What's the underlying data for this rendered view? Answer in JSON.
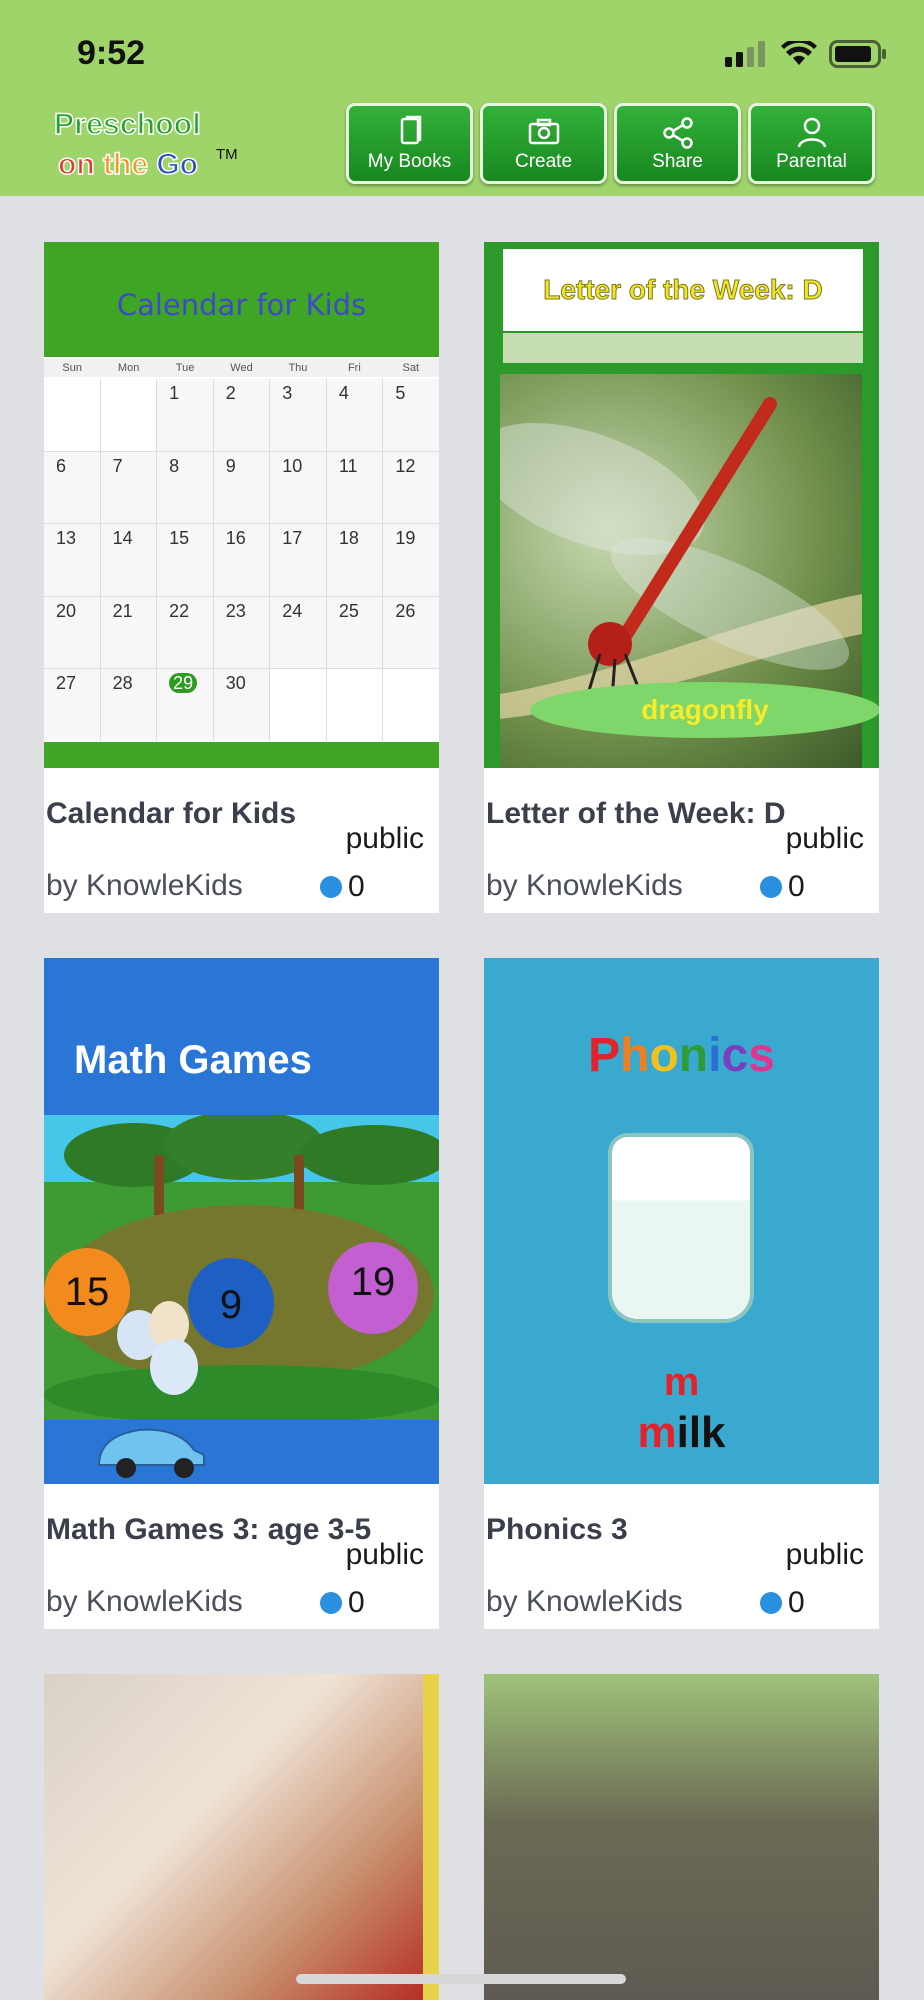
{
  "status_bar": {
    "time": "9:52"
  },
  "app": {
    "logo_line1": "Preschool",
    "logo_on": "on",
    "logo_the": "the",
    "logo_go": "Go",
    "logo_tm": "TM"
  },
  "nav": {
    "my_books": "My Books",
    "create": "Create",
    "share": "Share",
    "parental": "Parental"
  },
  "books": [
    {
      "title": "Calendar for Kids",
      "visibility": "public",
      "author": "by KnowleKids",
      "likes": "0",
      "cover": {
        "heading": "Calendar for Kids",
        "weekdays": [
          "Sun",
          "Mon",
          "Tue",
          "Wed",
          "Thu",
          "Fri",
          "Sat"
        ],
        "dates": [
          "",
          "",
          "1",
          "2",
          "3",
          "4",
          "5",
          "6",
          "7",
          "8",
          "9",
          "10",
          "11",
          "12",
          "13",
          "14",
          "15",
          "16",
          "17",
          "18",
          "19",
          "20",
          "21",
          "22",
          "23",
          "24",
          "25",
          "26",
          "27",
          "28",
          "29",
          "30",
          "",
          "",
          ""
        ],
        "today": "29"
      }
    },
    {
      "title": "Letter of the Week: D",
      "visibility": "public",
      "author": "by KnowleKids",
      "likes": "0",
      "cover": {
        "heading": "Letter of the Week: D",
        "caption": "dragonfly"
      }
    },
    {
      "title": "Math Games 3: age 3-5",
      "visibility": "public",
      "author": "by KnowleKids",
      "likes": "0",
      "cover": {
        "heading": "Math Games",
        "balloons": [
          "15",
          "9",
          "19"
        ]
      }
    },
    {
      "title": "Phonics 3",
      "visibility": "public",
      "author": "by KnowleKids",
      "likes": "0",
      "cover": {
        "heading": "Phonics",
        "letter": "m",
        "word_first": "m",
        "word_rest": "ilk"
      }
    }
  ],
  "colors": {
    "topbar": "#9fd46b",
    "nav_button": "#22992a",
    "background": "#dfe0e3",
    "like_icon": "#2b8fe0"
  }
}
